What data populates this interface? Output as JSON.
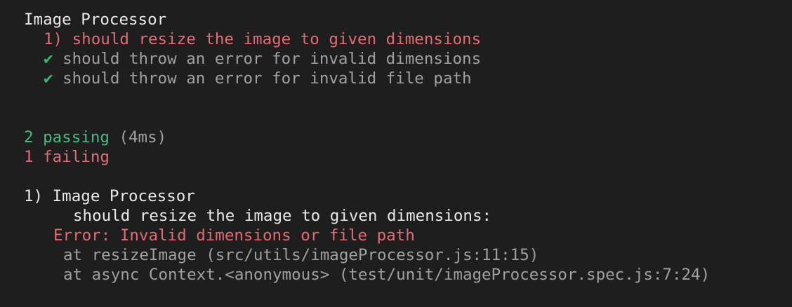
{
  "suite": {
    "title": "Image Processor",
    "tests": [
      {
        "status": "fail",
        "marker": "1)",
        "label": "should resize the image to given dimensions"
      },
      {
        "status": "pass",
        "marker": "✔",
        "label": "should throw an error for invalid dimensions"
      },
      {
        "status": "pass",
        "marker": "✔",
        "label": "should throw an error for invalid file path"
      }
    ]
  },
  "summary": {
    "passing": "2 passing",
    "duration": "(4ms)",
    "failing": "1 failing"
  },
  "failure": {
    "header": "1) Image Processor",
    "test_name": "should resize the image to given dimensions:",
    "error": "Error: Invalid dimensions or file path",
    "stack": [
      "at resizeImage (src/utils/imageProcessor.js:11:15)",
      "at async Context.<anonymous> (test/unit/imageProcessor.spec.js:7:24)"
    ]
  },
  "colors": {
    "background": "#1e1e1e",
    "text": "#e8e8e8",
    "fail": "#e06c75",
    "pass": "#3fbf7f",
    "muted": "#a0a0a0"
  }
}
